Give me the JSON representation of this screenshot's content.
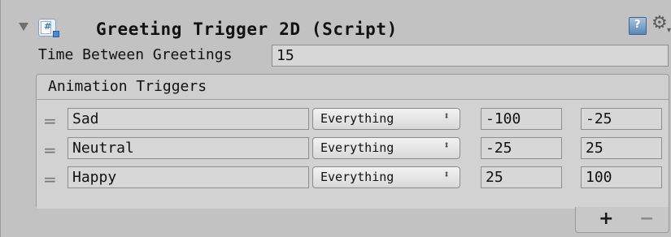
{
  "component": {
    "title": "Greeting Trigger 2D (Script)",
    "icons": {
      "foldout": "foldout-arrow",
      "script": "script-icon",
      "help": "help-icon",
      "settings": "gear-icon"
    }
  },
  "fields": {
    "time_between_greetings": {
      "label": "Time Between Greetings",
      "value": "15"
    }
  },
  "animation_triggers": {
    "label": "Animation Triggers",
    "rows": [
      {
        "name": "Sad",
        "mask": "Everything",
        "min": "-100",
        "max": "-25"
      },
      {
        "name": "Neutral",
        "mask": "Everything",
        "min": "-25",
        "max": "25"
      },
      {
        "name": "Happy",
        "mask": "Everything",
        "min": "25",
        "max": "100"
      }
    ],
    "drag_handle": "=",
    "popup_arrows": "⬍",
    "add_label": "+",
    "remove_label": "−"
  },
  "gear_caret": "▾",
  "colors": {
    "background": "#c2c2c2",
    "field": "#d7d7d7",
    "accent": "#3f8de0"
  }
}
